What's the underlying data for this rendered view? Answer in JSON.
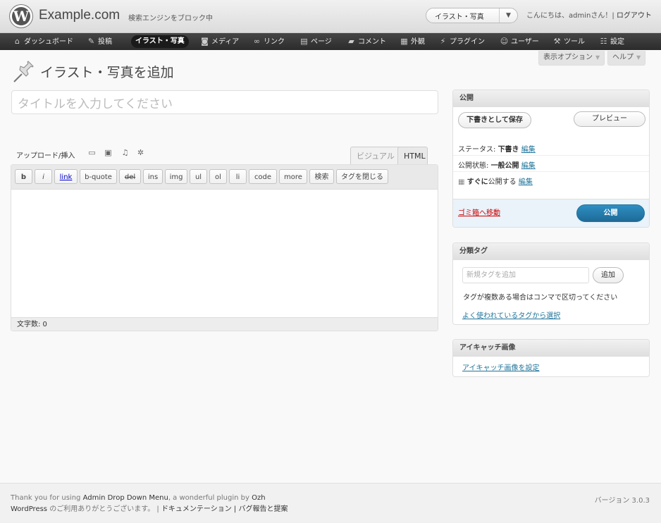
{
  "header": {
    "site_title": "Example.com",
    "site_status": "検索エンジンをブロック中",
    "favorite_action": "イラスト・写真",
    "greeting": "こんにちは、adminさん！|",
    "logout": "ログアウト"
  },
  "menu": [
    {
      "label": "ダッシュボード",
      "icon": "home-icon"
    },
    {
      "label": "投稿",
      "icon": "pin-icon"
    },
    {
      "label": "イラスト・写真",
      "icon": "none",
      "current": true
    },
    {
      "label": "メディア",
      "icon": "camera-icon"
    },
    {
      "label": "リンク",
      "icon": "link-icon"
    },
    {
      "label": "ページ",
      "icon": "page-icon"
    },
    {
      "label": "コメント",
      "icon": "comment-icon"
    },
    {
      "label": "外観",
      "icon": "appearance-icon"
    },
    {
      "label": "プラグイン",
      "icon": "plug-icon"
    },
    {
      "label": "ユーザー",
      "icon": "users-icon"
    },
    {
      "label": "ツール",
      "icon": "tools-icon"
    },
    {
      "label": "設定",
      "icon": "settings-icon"
    }
  ],
  "screen_options": "表示オプション",
  "help": "ヘルプ",
  "page_title": "イラスト・写真を追加",
  "title_placeholder": "タイトルを入力してください",
  "editor": {
    "upload_label": "アップロード/挿入",
    "tab_visual": "ビジュアル",
    "tab_html": "HTML",
    "quicktags": [
      "b",
      "i",
      "link",
      "b-quote",
      "del",
      "ins",
      "img",
      "ul",
      "ol",
      "li",
      "code",
      "more",
      "検索",
      "タグを閉じる"
    ],
    "word_count": "文字数: 0"
  },
  "publish": {
    "title": "公開",
    "save_draft": "下書きとして保存",
    "preview": "プレビュー",
    "status_label": "ステータス:",
    "status_value": "下書き",
    "visibility_label": "公開状態:",
    "visibility_value": "一般公開",
    "schedule_value": "すぐに",
    "schedule_suffix": "公開する",
    "edit": "編集",
    "trash": "ゴミ箱へ移動",
    "publish": "公開"
  },
  "tags": {
    "title": "分類タグ",
    "placeholder": "新規タグを追加",
    "add": "追加",
    "hint": "タグが複数ある場合はコンマで区切ってください",
    "popular": "よく使われているタグから選択"
  },
  "featured": {
    "title": "アイキャッチ画像",
    "link": "アイキャッチ画像を設定"
  },
  "footer": {
    "thanks_prefix": "Thank you for using ",
    "plugin": "Admin Drop Down Menu",
    "thanks_mid": ", a wonderful plugin by ",
    "author": "Ozh",
    "wp": "WordPress",
    "wp_suffix": " のご利用ありがとうございます。 | ",
    "docs": "ドキュメンテーション",
    "pipe": " | ",
    "bugs": "バグ報告と提案",
    "version": "バージョン 3.0.3"
  }
}
